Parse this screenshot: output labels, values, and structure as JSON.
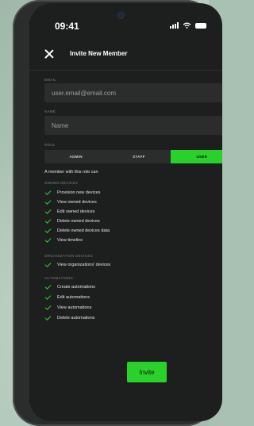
{
  "status": {
    "time": "09:41"
  },
  "header": {
    "title": "Invite New Member"
  },
  "form": {
    "email_label": "EMAIL",
    "email_placeholder": "user.email@email.com",
    "name_label": "NAME",
    "name_placeholder": "Name",
    "role_label": "ROLE",
    "roles": [
      "ADMIN",
      "STAFF",
      "USER"
    ],
    "selected_role": "USER"
  },
  "permissions": {
    "intro": "A member with this role can",
    "owned_title": "OWNED DEVICES",
    "owned": [
      "Provision new devices",
      "View owned devices",
      "Edit owned devices",
      "Delete owned devices",
      "Delete owned devices data",
      "View timeline"
    ],
    "org_title": "ORGANIZATION DEVICES",
    "org": [
      "View organizations' devices"
    ],
    "auto_title": "AUTOMATIONS",
    "auto": [
      "Create automations",
      "Edit automations",
      "View automations",
      "Delete automations"
    ]
  },
  "actions": {
    "invite_label": "Invite"
  },
  "colors": {
    "accent": "#2bd12b",
    "background": "#1d1f1e"
  }
}
